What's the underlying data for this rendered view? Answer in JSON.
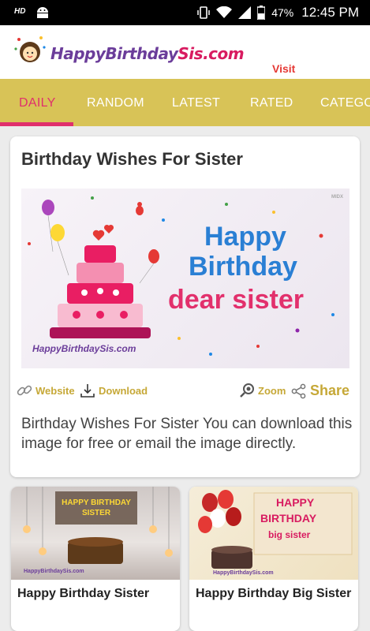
{
  "status_bar": {
    "hd": "HD",
    "battery": "47%",
    "time": "12:45 PM"
  },
  "header": {
    "logo_main": "HappyBirthday",
    "logo_accent": "Sis.com",
    "visit": "Visit"
  },
  "tabs": [
    "DAILY",
    "RANDOM",
    "LATEST",
    "RATED",
    "CATEGO"
  ],
  "active_tab": "DAILY",
  "card": {
    "title": "Birthday Wishes For Sister",
    "image": {
      "line1": "Happy",
      "line2": "Birthday",
      "line3": "dear sister",
      "logo": "HappyBirthdaySis.com",
      "watermark": "MIDX"
    },
    "actions": {
      "website": "Website",
      "download": "Download",
      "zoom": "Zoom",
      "share": "Share"
    },
    "description": "Birthday Wishes For Sister You can download this image for free or email the image directly."
  },
  "grid": [
    {
      "title": "Happy Birthday Sister",
      "banner": "HAPPY BIRTHDAY SISTER",
      "logo": "HappyBirthdaySis.com"
    },
    {
      "title": "Happy Birthday Big Sister",
      "banner_line1": "HAPPY",
      "banner_line2": "BIRTHDAY",
      "banner_line3": "big sister",
      "logo": "HappyBirthdaySis.com"
    }
  ],
  "colors": {
    "tab_bar": "#d8c357",
    "accent": "#e0306c",
    "action_gold": "#c6a837"
  }
}
